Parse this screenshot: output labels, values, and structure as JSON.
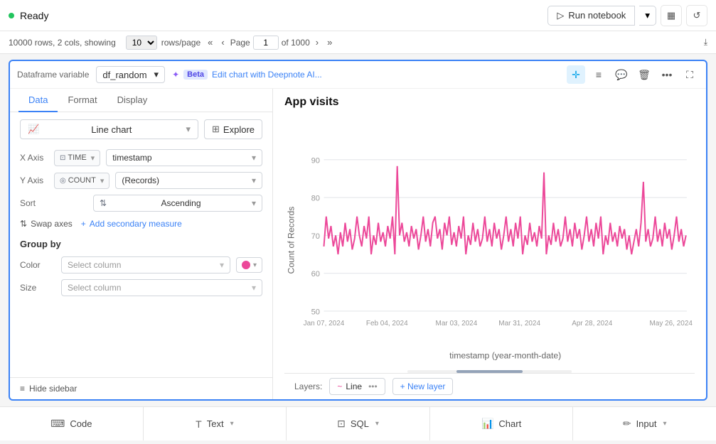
{
  "topbar": {
    "status_dot_color": "#22c55e",
    "status_text": "Ready",
    "run_btn_label": "Run notebook",
    "rows_info": "10000 rows, 2 cols, showing",
    "rows_count": "10",
    "rows_page": "rows/page",
    "page_label": "Page",
    "page_num": "1",
    "page_total": "of 1000"
  },
  "panel": {
    "df_label": "Dataframe variable",
    "df_value": "df_random",
    "beta_tag": "Beta",
    "ai_label": "Edit chart with Deepnote AI...",
    "icons": {
      "cursor": "⊹",
      "list": "≡",
      "chat": "💬",
      "trash": "🗑",
      "more": "•••",
      "expand": "⛶"
    }
  },
  "sidebar": {
    "tabs": [
      "Data",
      "Format",
      "Display"
    ],
    "active_tab": "Data",
    "chart_type": "Line chart",
    "explore_label": "Explore",
    "xaxis": {
      "label": "X Axis",
      "type": "TIME",
      "column": "timestamp"
    },
    "yaxis": {
      "label": "Y Axis",
      "type": "COUNT",
      "column": "(Records)"
    },
    "sort": {
      "label": "Sort",
      "value": "Ascending"
    },
    "swap_label": "Swap axes",
    "add_secondary_label": "Add secondary measure",
    "group_by_title": "Group by",
    "color_label": "Color",
    "size_label": "Size",
    "select_column_placeholder": "Select column",
    "hide_sidebar_label": "Hide sidebar"
  },
  "chart": {
    "title": "App visits",
    "y_axis_label": "Count of Records",
    "x_axis_label": "timestamp (year-month-date)",
    "x_ticks": [
      "Jan 07, 2024",
      "Feb 04, 2024",
      "Mar 03, 2024",
      "Mar 31, 2024",
      "Apr 28, 2024",
      "May 26, 2024"
    ],
    "y_ticks": [
      "50",
      "60",
      "70",
      "80",
      "90"
    ],
    "line_color": "#ec4899",
    "layers_label": "Layers:",
    "layer_name": "Line",
    "new_layer_label": "+ New layer"
  },
  "bottom_bar": {
    "items": [
      {
        "label": "Code",
        "icon": "code",
        "has_chevron": false
      },
      {
        "label": "Text",
        "icon": "text",
        "has_chevron": true
      },
      {
        "label": "SQL",
        "icon": "sql",
        "has_chevron": true
      },
      {
        "label": "Chart",
        "icon": "chart",
        "has_chevron": false
      },
      {
        "label": "Input",
        "icon": "input",
        "has_chevron": true
      }
    ]
  }
}
